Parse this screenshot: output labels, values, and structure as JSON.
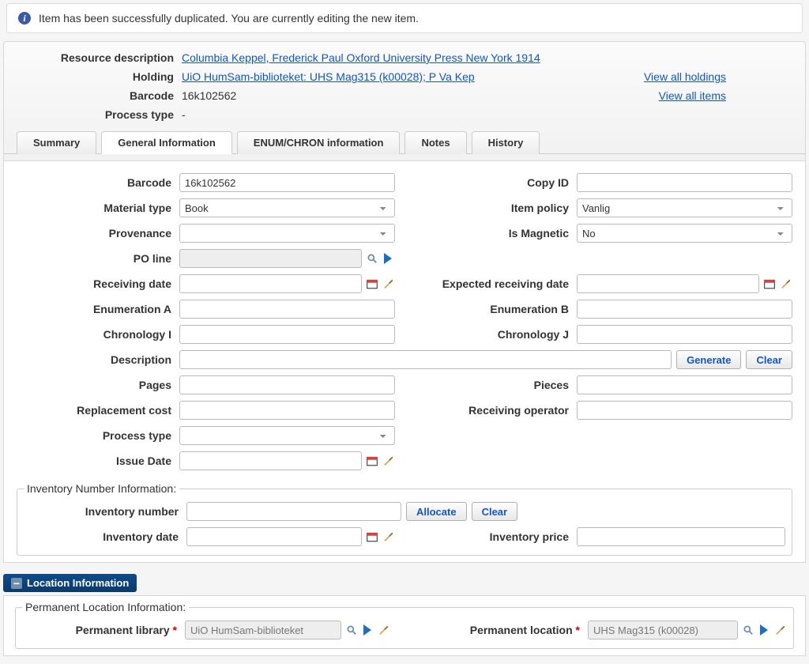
{
  "info_message": "Item has been successfully duplicated. You are currently editing the new item.",
  "resource_description_label": "Resource description",
  "resource_description_link": "Columbia Keppel, Frederick Paul Oxford University Press New York 1914",
  "holding_label": "Holding",
  "holding_link": "UiO HumSam-biblioteket: UHS Mag315 (k00028); P Va Kep",
  "view_all_holdings": "View all holdings",
  "barcode_label": "Barcode",
  "barcode_value": "16k102562",
  "view_all_items": "View all items",
  "process_type_label": "Process type",
  "process_type_value": "-",
  "tabs": {
    "summary": "Summary",
    "general": "General Information",
    "enum": "ENUM/CHRON information",
    "notes": "Notes",
    "history": "History"
  },
  "labels": {
    "barcode": "Barcode",
    "material_type": "Material type",
    "provenance": "Provenance",
    "po_line": "PO line",
    "receiving_date": "Receiving date",
    "enum_a": "Enumeration A",
    "chron_i": "Chronology I",
    "description": "Description",
    "pages": "Pages",
    "replacement_cost": "Replacement cost",
    "process_type_f": "Process type",
    "issue_date": "Issue Date",
    "copy_id": "Copy ID",
    "item_policy": "Item policy",
    "is_magnetic": "Is Magnetic",
    "expected_receiving": "Expected receiving date",
    "enum_b": "Enumeration B",
    "chron_j": "Chronology J",
    "pieces": "Pieces",
    "receiving_operator": "Receiving operator",
    "inventory_number": "Inventory number",
    "inventory_date": "Inventory date",
    "inventory_price": "Inventory price",
    "permanent_library": "Permanent library",
    "permanent_location": "Permanent location"
  },
  "values": {
    "barcode": "16k102562",
    "material_type": "Book",
    "item_policy": "Vanlig",
    "is_magnetic": "No",
    "permanent_library": "UiO HumSam-biblioteket",
    "permanent_location": "UHS Mag315 (k00028)"
  },
  "buttons": {
    "generate": "Generate",
    "clear": "Clear",
    "allocate": "Allocate"
  },
  "fieldsets": {
    "inv_number": "Inventory Number Information:",
    "perm_loc": "Permanent Location Information:"
  },
  "section_location": "Location Information"
}
